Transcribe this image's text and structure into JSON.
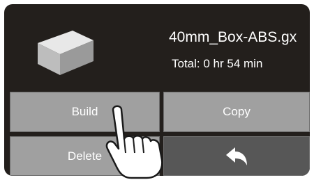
{
  "file": {
    "name": "40mm_Box-ABS.gx",
    "total_time": "Total: 0 hr 54 min",
    "thumbnail_icon": "box-3d-icon"
  },
  "buttons": {
    "build": "Build",
    "copy": "Copy",
    "delete": "Delete",
    "back_icon": "back-arrow-icon"
  },
  "overlay_icon": "pointing-hand-icon",
  "colors": {
    "screen_bg": "#231f1c",
    "button_bg": "#a0a0a0",
    "back_button_bg": "#575757",
    "text": "#ffffff"
  }
}
